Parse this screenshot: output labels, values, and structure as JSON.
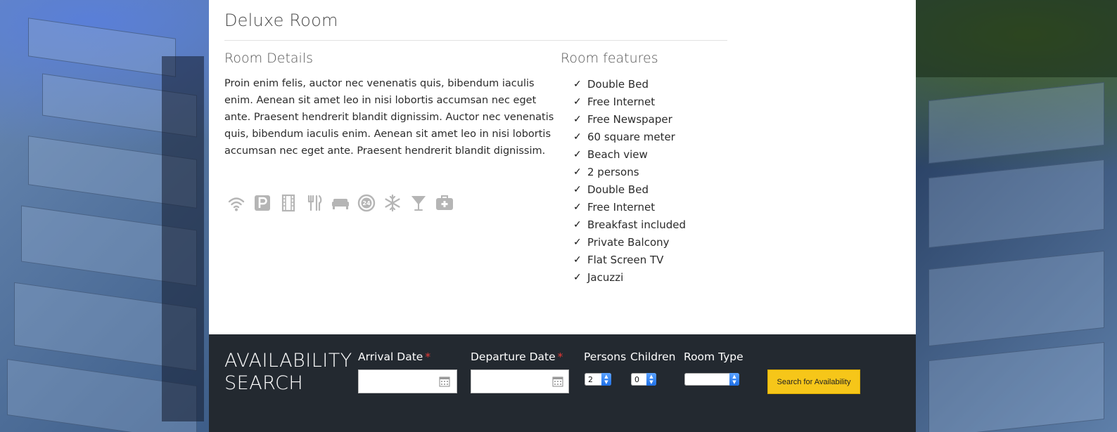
{
  "room": {
    "title": "Deluxe Room",
    "details_heading": "Room Details",
    "details_text": "Proin enim felis, auctor nec venenatis quis, bibendum iaculis enim. Aenean sit amet leo in nisi lobortis accumsan nec eget ante. Praesent hendrerit blandit dignissim. Auctor nec venenatis quis, bibendum iaculis enim. Aenean sit amet leo in nisi lobortis accumsan nec eget ante. Praesent hendrerit blandit dignissim.",
    "features_heading": "Room features",
    "features": [
      "Double Bed",
      "Free Internet",
      "Free Newspaper",
      "60 square meter",
      "Beach view",
      "2 persons",
      "Double Bed",
      "Free Internet",
      "Breakfast included",
      "Private Balcony",
      "Flat Screen TV",
      "Jacuzzi"
    ],
    "amenity_icons": [
      "wifi-icon",
      "parking-icon",
      "film-icon",
      "restaurant-icon",
      "bed-icon",
      "24h-service-icon",
      "air-conditioning-icon",
      "bar-icon",
      "first-aid-icon"
    ],
    "icon_color": "#b5b5b5"
  },
  "availability": {
    "title_line1": "AVAILABILITY",
    "title_line2": "SEARCH",
    "arrival_label": "Arrival Date",
    "departure_label": "Departure Date",
    "required_mark": "*",
    "arrival_value": "",
    "departure_value": "",
    "persons_label": "Persons",
    "persons_value": "2",
    "children_label": "Children",
    "children_value": "0",
    "room_type_label": "Room Type",
    "room_type_value": "",
    "search_button": "Search for Availability",
    "bar_color": "#232930",
    "button_color": "#f6c619",
    "required_color": "#e53935"
  }
}
